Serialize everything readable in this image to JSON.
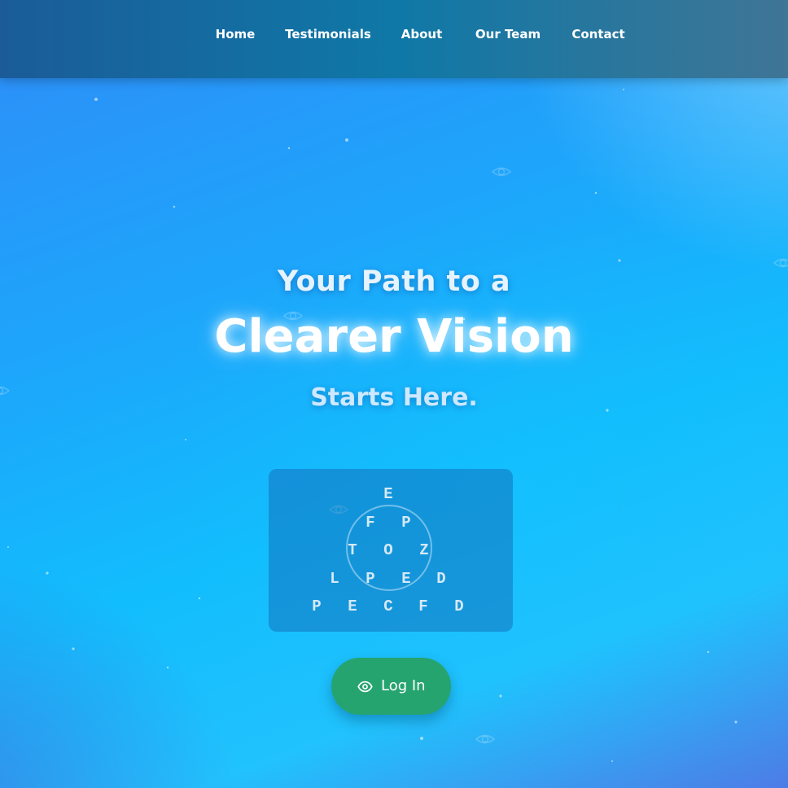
{
  "nav": {
    "items": [
      {
        "label": "Home"
      },
      {
        "label": "Testimonials"
      },
      {
        "label": "About"
      },
      {
        "label": "Our Team"
      },
      {
        "label": "Contact"
      }
    ]
  },
  "hero": {
    "line1": "Your Path to a",
    "line2": "Clearer Vision",
    "line3": "Starts Here."
  },
  "eye_chart": {
    "rows": [
      [
        "E"
      ],
      [
        "F",
        "P"
      ],
      [
        "T",
        "O",
        "Z"
      ],
      [
        "L",
        "P",
        "E",
        "D"
      ],
      [
        "P",
        "E",
        "C",
        "F",
        "D"
      ]
    ]
  },
  "login": {
    "label": "Log In",
    "icon": "eye-icon"
  },
  "colors": {
    "background_start": "#2f8cf8",
    "background_end": "#21c2fd",
    "nav_background": "#0f78a6",
    "button": "#26a46f",
    "text": "#ffffff"
  }
}
